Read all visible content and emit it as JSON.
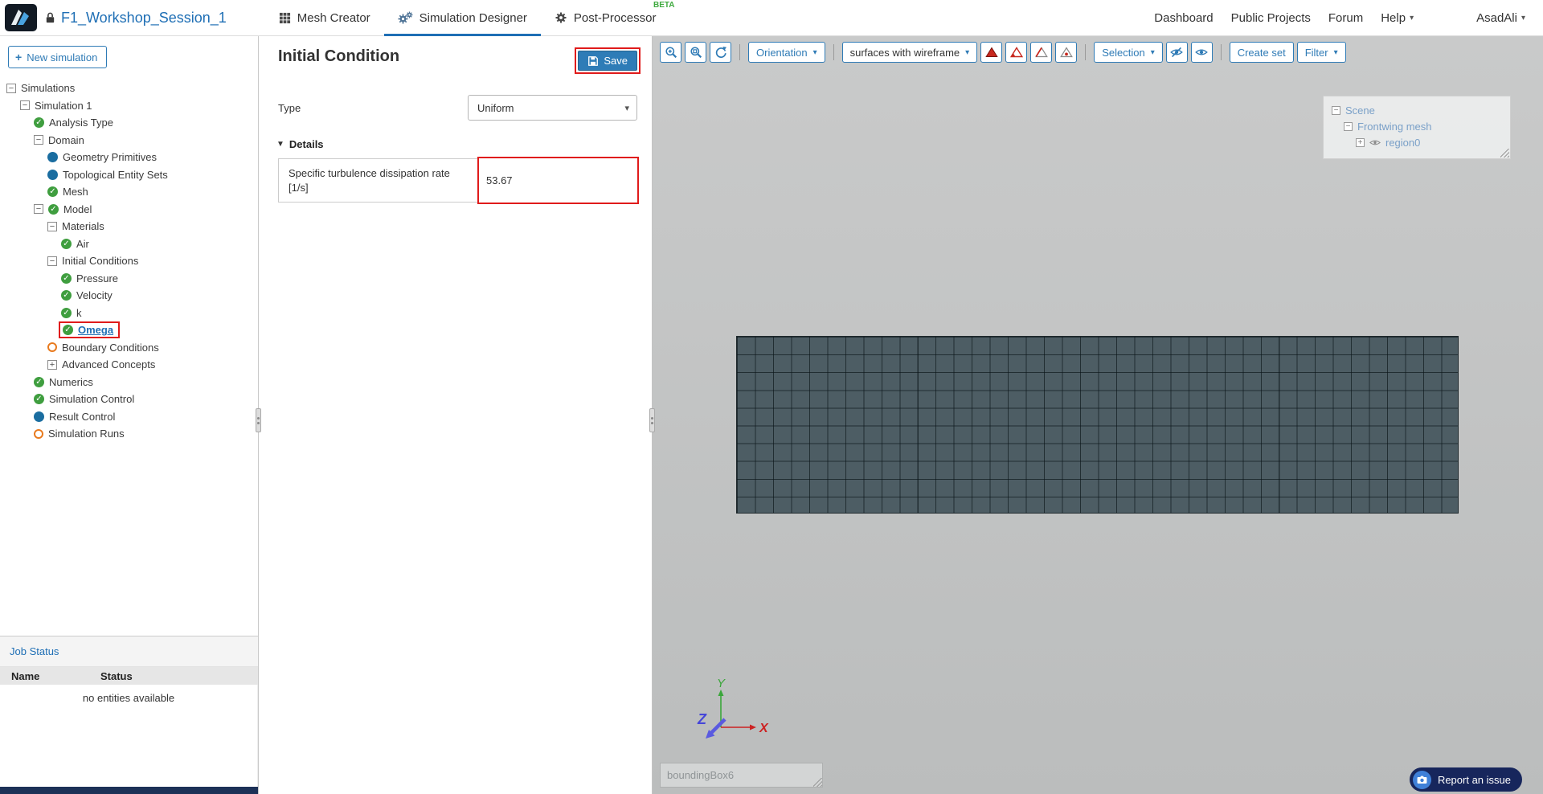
{
  "colors": {
    "accent": "#2f7bb6",
    "annotation_red": "#e01b1b",
    "beta_green": "#3faa3f",
    "mesh_fill": "#4d5d64",
    "report_navy": "#17265c"
  },
  "header": {
    "project_title": "F1_Workshop_Session_1",
    "tabs": [
      {
        "label": "Mesh Creator",
        "icon": "grid-icon",
        "active": false
      },
      {
        "label": "Simulation Designer",
        "icon": "gears-icon",
        "active": true
      },
      {
        "label": "Post-Processor",
        "icon": "gear-icon",
        "active": false,
        "badge": "BETA"
      }
    ],
    "nav_items": [
      {
        "label": "Dashboard"
      },
      {
        "label": "Public Projects"
      },
      {
        "label": "Forum"
      },
      {
        "label": "Help",
        "caret": true
      },
      {
        "label": "AsadAli",
        "caret": true
      }
    ]
  },
  "sidebar": {
    "new_simulation_label": "New simulation",
    "tree": [
      {
        "label": "Simulations",
        "indent": 0,
        "toggle": "collapse"
      },
      {
        "label": "Simulation 1",
        "indent": 1,
        "toggle": "collapse"
      },
      {
        "label": "Analysis Type",
        "indent": 2,
        "icon": "check"
      },
      {
        "label": "Domain",
        "indent": 2,
        "toggle": "collapse"
      },
      {
        "label": "Geometry Primitives",
        "indent": 3,
        "icon": "dot"
      },
      {
        "label": "Topological Entity Sets",
        "indent": 3,
        "icon": "dot"
      },
      {
        "label": "Mesh",
        "indent": 3,
        "icon": "check"
      },
      {
        "label": "Model",
        "indent": 2,
        "toggle": "collapse",
        "icon": "check"
      },
      {
        "label": "Materials",
        "indent": 3,
        "toggle": "collapse"
      },
      {
        "label": "Air",
        "indent": 4,
        "icon": "check"
      },
      {
        "label": "Initial Conditions",
        "indent": 3,
        "toggle": "collapse"
      },
      {
        "label": "Pressure",
        "indent": 4,
        "icon": "check"
      },
      {
        "label": "Velocity",
        "indent": 4,
        "icon": "check"
      },
      {
        "label": "k",
        "indent": 4,
        "icon": "check"
      },
      {
        "label": "Omega",
        "indent": 4,
        "icon": "check",
        "selected": true,
        "annotated": true
      },
      {
        "label": "Boundary Conditions",
        "indent": 3,
        "icon": "warning"
      },
      {
        "label": "Advanced Concepts",
        "indent": 3,
        "toggle": "expand"
      },
      {
        "label": "Numerics",
        "indent": 2,
        "icon": "check"
      },
      {
        "label": "Simulation Control",
        "indent": 2,
        "icon": "check"
      },
      {
        "label": "Result Control",
        "indent": 2,
        "icon": "dot"
      },
      {
        "label": "Simulation Runs",
        "indent": 2,
        "icon": "warning"
      }
    ],
    "job_status": {
      "title": "Job Status",
      "columns": [
        "Name",
        "Status"
      ],
      "empty_message": "no entities available"
    }
  },
  "panel": {
    "title": "Initial Condition",
    "save_label": "Save",
    "type_label": "Type",
    "type_value": "Uniform",
    "details_label": "Details",
    "fields": [
      {
        "label": "Specific turbulence dissipation rate [1/s]",
        "value": "53.67"
      }
    ]
  },
  "viewport": {
    "toolbar": [
      {
        "type": "icon",
        "icon": "zoom-in"
      },
      {
        "type": "icon",
        "icon": "zoom-extents"
      },
      {
        "type": "icon",
        "icon": "refresh"
      },
      {
        "type": "sep"
      },
      {
        "type": "dropdown",
        "label": "Orientation"
      },
      {
        "type": "sep"
      },
      {
        "type": "select",
        "label": "surfaces with wireframe"
      },
      {
        "type": "icon",
        "icon": "tri-solid"
      },
      {
        "type": "icon",
        "icon": "tri-outline"
      },
      {
        "type": "icon",
        "icon": "tri-edge"
      },
      {
        "type": "icon",
        "icon": "tri-mark"
      },
      {
        "type": "sep"
      },
      {
        "type": "dropdown",
        "label": "Selection"
      },
      {
        "type": "icon",
        "icon": "eye-off"
      },
      {
        "type": "icon",
        "icon": "eye"
      },
      {
        "type": "sep"
      },
      {
        "type": "button",
        "label": "Create set"
      },
      {
        "type": "dropdown",
        "label": "Filter"
      }
    ],
    "scene_tree": [
      {
        "label": "Scene",
        "indent": 0,
        "toggle": "collapse"
      },
      {
        "label": "Frontwing mesh",
        "indent": 1,
        "toggle": "collapse"
      },
      {
        "label": "region0",
        "indent": 2,
        "toggle": "expand",
        "eye": true
      }
    ],
    "axes": {
      "x": "X",
      "y": "Y",
      "z": "Z"
    },
    "bounding_box_label": "boundingBox6",
    "report_issue_label": "Report an issue"
  }
}
